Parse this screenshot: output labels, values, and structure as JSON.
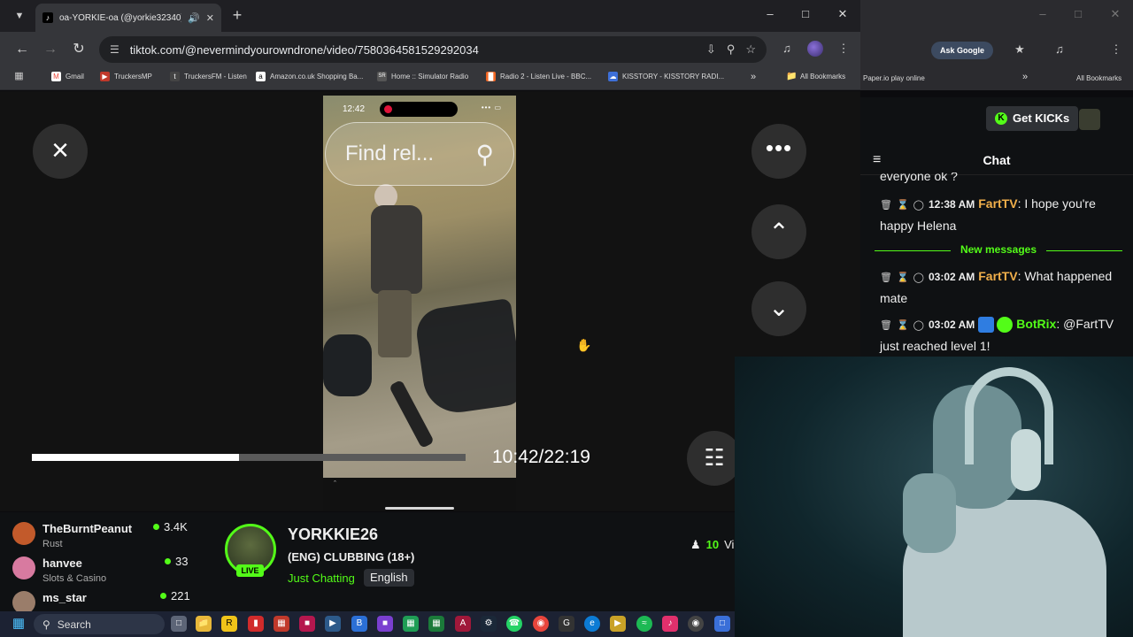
{
  "browser": {
    "tab_title": "oa-YORKIE-oa (@yorkie32340) | TikTo",
    "url": "tiktok.com/@nevermindyourowndrone/video/7580364581529292034"
  },
  "bookmarks": [
    {
      "label": "Gmail",
      "icon": "gmail-icon",
      "color": "#ea4335"
    },
    {
      "label": "TruckersMP",
      "icon": "truck-icon",
      "color": "#c0392b"
    },
    {
      "label": "TruckersFM - Listen",
      "icon": "t-icon",
      "color": "#444444"
    },
    {
      "label": "Amazon.co.uk Shopping Ba...",
      "icon": "amazon-icon",
      "color": "#ffffff"
    },
    {
      "label": "Home :: Simulator Radio",
      "icon": "sr-icon",
      "color": "#555555"
    },
    {
      "label": "Radio 2 - Listen Live - BBC...",
      "icon": "radio-icon",
      "color": "#f26522"
    },
    {
      "label": "KISSTORY - KISSTORY RADI...",
      "icon": "kiss-icon",
      "color": "#3d6fd8"
    }
  ],
  "all_bookmarks": "All Bookmarks",
  "right_window": {
    "ask_google": "Ask Google",
    "bookmark": "Paper.io play online",
    "all_bookmarks": "All Bookmarks"
  },
  "video": {
    "phone_time": "12:42",
    "search_text": "Find rel...",
    "time_display": "10:42/22:19",
    "progress_fraction": 0.477
  },
  "recommended": [
    {
      "name": "TheBurntPeanut",
      "category": "Rust",
      "viewers": "3.4K",
      "color": "#c25a2b"
    },
    {
      "name": "hanvee",
      "category": "Slots & Casino",
      "viewers": "33",
      "color": "#d87aa0"
    },
    {
      "name": "ms_star",
      "category": "",
      "viewers": "221",
      "color": "#9a7d6a"
    }
  ],
  "stream": {
    "streamer": "YORKKIE26",
    "live": "LIVE",
    "title": "(ENG) CLUBBING (18+)",
    "category": "Just Chatting",
    "language": "English",
    "viewers": "10",
    "viewers_suffix": "Vi"
  },
  "chat": {
    "get_kicks": "Get KICKs",
    "title": "Chat",
    "partial_line": "everyone ok ?",
    "new_messages": "New messages",
    "messages": [
      {
        "time": "12:38 AM",
        "user": "FartTV",
        "user_color": "#f2b04b",
        "text": ": I hope you're happy Helena"
      },
      {
        "time": "03:02 AM",
        "user": "FartTV",
        "user_color": "#f2b04b",
        "text": ": What happened mate"
      },
      {
        "time": "03:02 AM",
        "user": "BotRix",
        "user_color": "#53fc18",
        "text": ": @FartTV just reached level 1!"
      }
    ]
  },
  "taskbar": {
    "search_label": "Search"
  },
  "accent": "#53fc18"
}
